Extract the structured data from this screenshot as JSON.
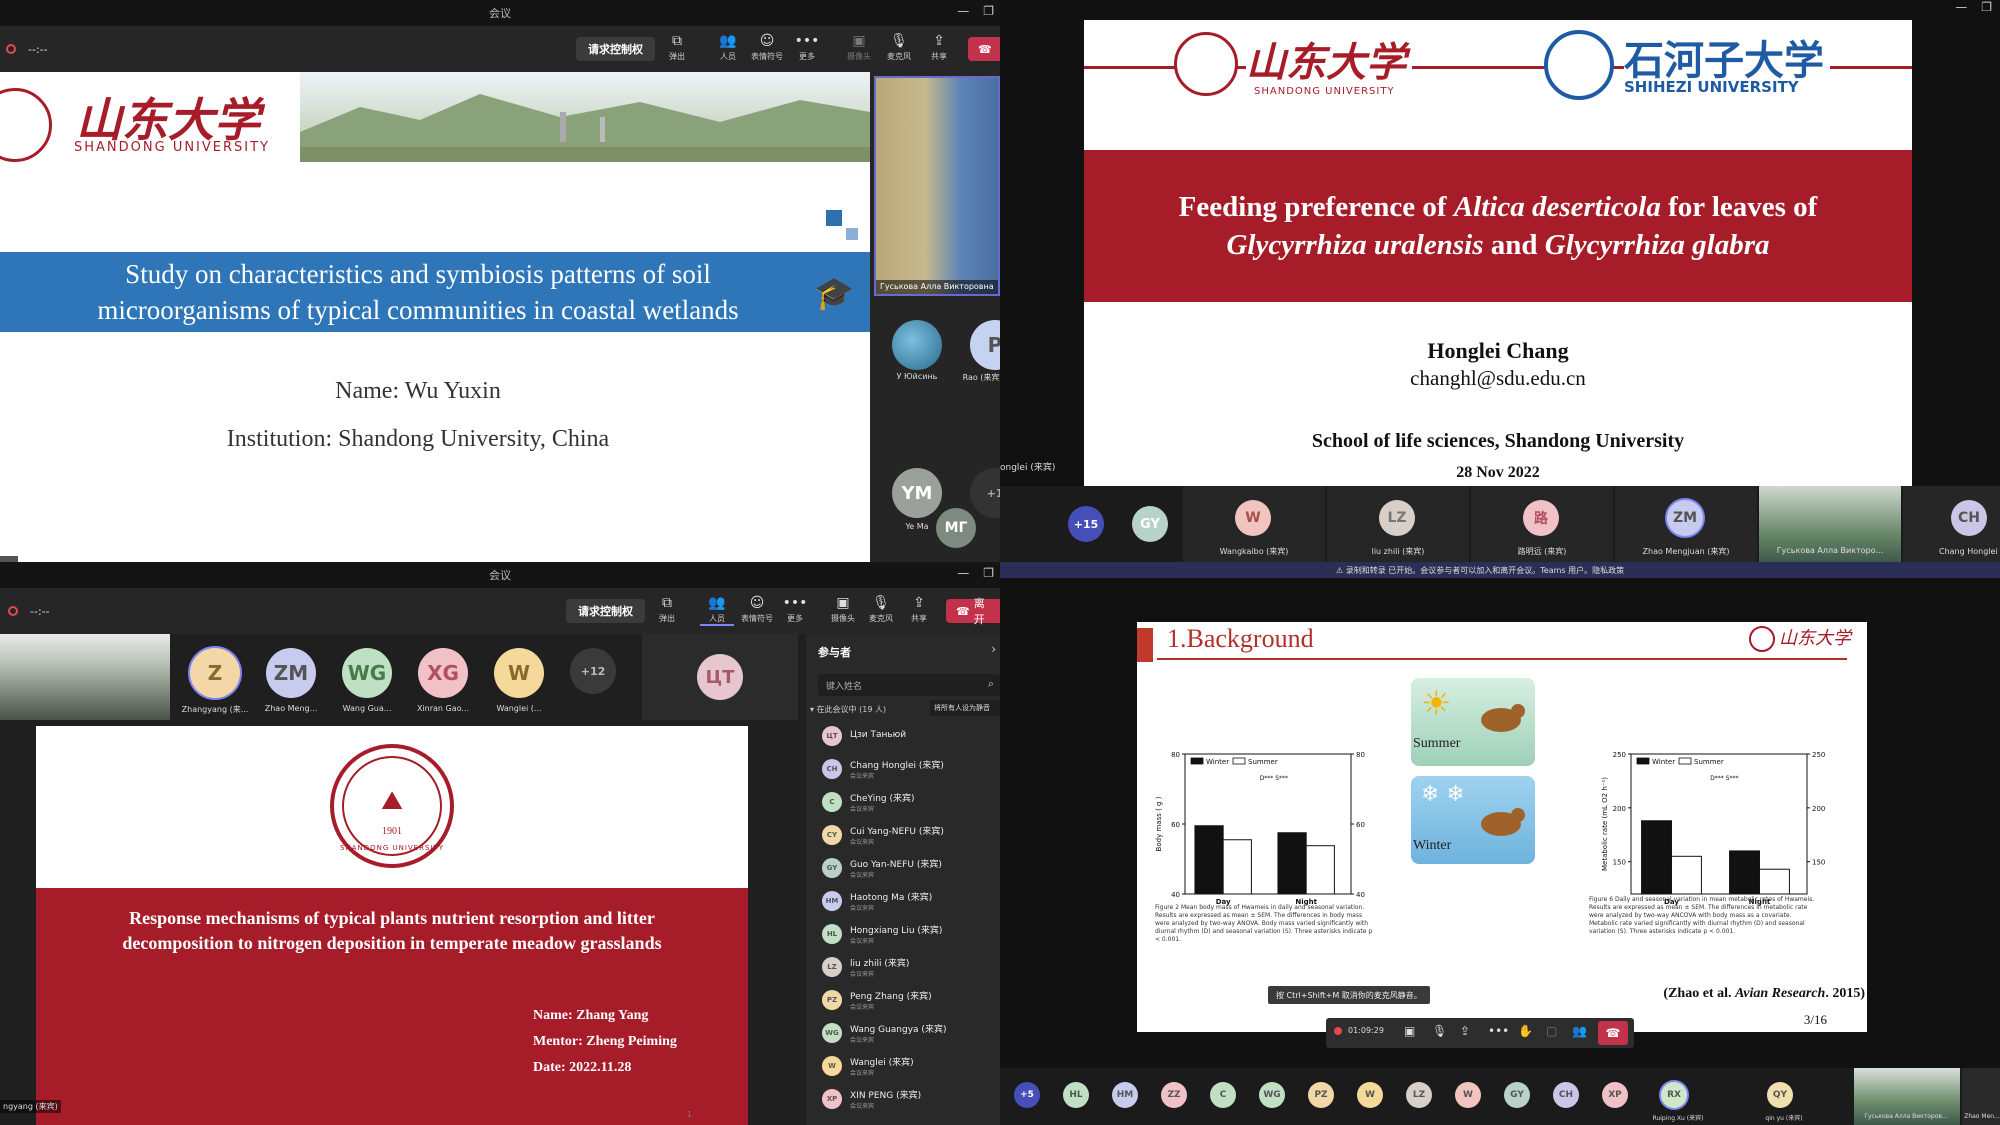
{
  "q1": {
    "window_title": "会议",
    "timer": "--:--",
    "request_control_label": "请求控制权",
    "toolbar": [
      {
        "icon": "pop-out-icon",
        "label": "弹出"
      },
      {
        "icon": "people-icon",
        "label": "人员"
      },
      {
        "icon": "reactions-icon",
        "label": "表情符号"
      },
      {
        "icon": "more-icon",
        "label": "更多"
      },
      {
        "icon": "camera-icon",
        "label": "摄像头"
      },
      {
        "icon": "mic-icon",
        "label": "麦克风"
      },
      {
        "icon": "share-icon",
        "label": "共享"
      }
    ],
    "slide": {
      "university_cn": "山东大学",
      "university_en": "SHANDONG UNIVERSITY",
      "title_line1": "Study on characteristics and symbiosis patterns of soil",
      "title_line2": "microorganisms of typical communities in coastal wetlands",
      "name": "Name: Wu Yuxin",
      "institution": "Institution: Shandong University, China"
    },
    "video_label": "Гуськова Алла Викторовна",
    "side_participants": [
      {
        "initials": "",
        "name": "У Юйсинь",
        "photo": true
      },
      {
        "initials": "P",
        "name": "Rao (来宾",
        "color": "#c6d3f0"
      },
      {
        "initials": "YM",
        "name": "Ye Ma",
        "color": "#9aa09a"
      },
      {
        "initials": "+1",
        "name": "",
        "color": "#333"
      },
      {
        "initials": "МГ",
        "name": "",
        "color": "#7d8a80"
      }
    ]
  },
  "q2": {
    "uni1_cn": "山东大学",
    "uni1_en": "SHANDONG UNIVERSITY",
    "uni2_cn": "石河子大学",
    "uni2_en": "SHIHEZI UNIVERSITY",
    "title_part1": "Feeding preference of ",
    "title_italic1": "Altica deserticola",
    "title_part2": " for leaves of",
    "title_italic2": "Glycyrrhiza uralensis",
    "title_part3": " and ",
    "title_italic3": "Glycyrrhiza glabra",
    "author": "Honglei Chang",
    "email": "changhl@sdu.edu.cn",
    "school": "School of life sciences, Shandong University",
    "date": "28 Nov 2022",
    "presenter_label": "onglei (来宾)",
    "strip": [
      {
        "initials": "+15",
        "name": "",
        "color": "#464eb8"
      },
      {
        "initials": "GY",
        "name": "",
        "color": "#b9d2c9"
      },
      {
        "initials": "W",
        "name": "Wangkaibo (来宾)",
        "color": "#f2c4c0"
      },
      {
        "initials": "LZ",
        "name": "liu zhili (来宾)",
        "color": "#d8cfc8"
      },
      {
        "initials": "路",
        "name": "路明远 (来宾)",
        "color": "#f0c2c8"
      },
      {
        "initials": "ZM",
        "name": "Zhao Mengjuan (来宾)",
        "color": "#c7cbee"
      },
      {
        "initials": "",
        "name": "Гуськова Алла Викторо...",
        "photo": true
      },
      {
        "initials": "CH",
        "name": "Chang Honglei (来宾)",
        "color": "#cbc6e8"
      }
    ],
    "notice": "录制和转录 已开始。会议参与者可以加入和离开会议。Teams 用户。隐私政策"
  },
  "q3": {
    "window_title": "会议",
    "timer": "--:--",
    "request_control_label": "请求控制权",
    "leave_label": "离开",
    "toolbar": [
      {
        "icon": "pop-out-icon",
        "label": "弹出"
      },
      {
        "icon": "people-icon",
        "label": "人员"
      },
      {
        "icon": "reactions-icon",
        "label": "表情符号"
      },
      {
        "icon": "more-icon",
        "label": "更多"
      },
      {
        "icon": "camera-icon",
        "label": "摄像头"
      },
      {
        "icon": "mic-icon",
        "label": "麦克风"
      },
      {
        "icon": "share-icon",
        "label": "共享"
      }
    ],
    "strip": [
      {
        "initials": "Z",
        "name": "Zhangyang (来...",
        "color": "#f3d7a6"
      },
      {
        "initials": "ZM",
        "name": "Zhao Meng...",
        "color": "#c7cbee"
      },
      {
        "initials": "WG",
        "name": "Wang Gua...",
        "color": "#bfe0c2"
      },
      {
        "initials": "XG",
        "name": "Xinran Gao...",
        "color": "#f0c2c8"
      },
      {
        "initials": "W",
        "name": "Wanglei (...",
        "color": "#f4d99a"
      },
      {
        "initials": "+12",
        "name": "",
        "color": "#3a3a3a"
      }
    ],
    "big_avatar": {
      "initials": "ЦТ",
      "color": "#e8c6d0"
    },
    "slide": {
      "year": "1901",
      "uni_en": "SHANDONG UNIVERSITY",
      "title_line1": "Response mechanisms of typical plants nutrient resorption and litter",
      "title_line2": "decomposition to nitrogen deposition in temperate meadow grasslands",
      "name": "Name:  Zhang Yang",
      "mentor": "Mentor:  Zheng Peiming",
      "date": "Date:  2022.11.28",
      "page": "1"
    },
    "presenter_label": "ngyang (来宾)",
    "panel": {
      "title": "参与者",
      "search_placeholder": "键入姓名",
      "mute_all_label": "将所有人设为静音",
      "group_label": "在此会议中 (19 人)",
      "participants": [
        {
          "initials": "ЦТ",
          "name": "Цзи Таньюй",
          "sub": "",
          "color": "#e8c6d0"
        },
        {
          "initials": "CH",
          "name": "Chang Honglei (来宾)",
          "sub": "会议来宾",
          "color": "#cbc6e8"
        },
        {
          "initials": "C",
          "name": "CheYing (来宾)",
          "sub": "会议来宾",
          "color": "#bfe0c2"
        },
        {
          "initials": "CY",
          "name": "Cui Yang-NEFU (来宾)",
          "sub": "会议来宾",
          "color": "#f3d7a6"
        },
        {
          "initials": "GY",
          "name": "Guo Yan-NEFU (来宾)",
          "sub": "会议来宾",
          "color": "#b9d2c9"
        },
        {
          "initials": "HM",
          "name": "Haotong Ma (来宾)",
          "sub": "会议来宾",
          "color": "#c7cbee"
        },
        {
          "initials": "HL",
          "name": "Hongxiang Liu (来宾)",
          "sub": "会议来宾",
          "color": "#bfe0c2"
        },
        {
          "initials": "LZ",
          "name": "liu zhili (来宾)",
          "sub": "会议来宾",
          "color": "#d8cfc8"
        },
        {
          "initials": "PZ",
          "name": "Peng Zhang (来宾)",
          "sub": "会议来宾",
          "color": "#f3d7a6"
        },
        {
          "initials": "WG",
          "name": "Wang Guangya (来宾)",
          "sub": "会议来宾",
          "color": "#bfe0c2"
        },
        {
          "initials": "W",
          "name": "Wanglei (来宾)",
          "sub": "会议来宾",
          "color": "#f4d99a"
        },
        {
          "initials": "XP",
          "name": "XIN PENG (来宾)",
          "sub": "会议来宾",
          "color": "#f0c2c8"
        }
      ]
    }
  },
  "q4": {
    "heading": "1.Background",
    "summer_label": "Summer",
    "winter_label": "Winter",
    "citation_prefix": "(Zhao et al. ",
    "citation_journal": "Avian Research",
    "citation_suffix": ". 2015)",
    "page": "3/16",
    "toast": "按 Ctrl+Shift+M 取消你的麦克风静音。",
    "call_timer": "01:09:29",
    "fig2_caption": "Figure 2 Mean body mass of Hwameis in daily and seasonal variation. Results are expressed as mean ± SEM. The differences in body mass were analyzed by two-way ANOVA. Body mass varied significantly with diurnal rhythm (D) and seasonal variation (S). Three asterisks indicate p < 0.001.",
    "fig6_caption": "Figure 6 Daily and seasonal variation in mean metabolic rates of Hwameis. Results are expressed as mean ± SEM. The differences in metabolic rate were analyzed by two-way ANCOVA with body mass as a covariate. Metabolic rate varied significantly with diurnal rhythm (D) and seasonal variation (S). Three asterisks indicate p < 0.001.",
    "strip": [
      {
        "initials": "+5",
        "color": "#464eb8"
      },
      {
        "initials": "HL",
        "color": "#bfe0c2"
      },
      {
        "initials": "HM",
        "color": "#c7cbee"
      },
      {
        "initials": "ZZ",
        "color": "#f0c2c8"
      },
      {
        "initials": "C",
        "color": "#bfe0c2"
      },
      {
        "initials": "WG",
        "color": "#bfe0c2"
      },
      {
        "initials": "PZ",
        "color": "#f3d7a6"
      },
      {
        "initials": "W",
        "color": "#f4d99a"
      },
      {
        "initials": "LZ",
        "color": "#d8cfc8"
      },
      {
        "initials": "W",
        "color": "#f2c4c0"
      },
      {
        "initials": "GY",
        "color": "#b9d2c9"
      },
      {
        "initials": "CH",
        "color": "#cbc6e8"
      },
      {
        "initials": "XP",
        "color": "#f0c2c8"
      },
      {
        "initials": "RX",
        "color": "#cfe8c8"
      },
      {
        "initials": "QY",
        "color": "#f0e0b0"
      }
    ],
    "strip_named": {
      "rx": "Ruiping Xu (来宾)",
      "qy": "qin yu (来宾)",
      "photo": "Гуськова Алла Викторов...",
      "last": "Zhao Men..."
    }
  },
  "chart_data": [
    {
      "type": "bar",
      "title": "",
      "xlabel": "",
      "ylabel": "Body mass ( g )",
      "categories": [
        "Day",
        "Night"
      ],
      "series": [
        {
          "name": "Winter",
          "values": [
            59.5,
            57.5
          ],
          "color": "#111111"
        },
        {
          "name": "Summer",
          "values": [
            55.5,
            53.8
          ],
          "color": "#ffffff"
        }
      ],
      "ylim": [
        40,
        80
      ],
      "yticks": [
        40,
        60,
        80
      ],
      "annotation": "D***  S***",
      "legend": "top-left"
    },
    {
      "type": "bar",
      "title": "",
      "xlabel": "",
      "ylabel": "Metabolic rate (mL O2 h⁻¹)",
      "categories": [
        "Day",
        "Night"
      ],
      "series": [
        {
          "name": "Winter",
          "values": [
            188,
            160
          ],
          "color": "#111111"
        },
        {
          "name": "Summer",
          "values": [
            155,
            143
          ],
          "color": "#ffffff"
        }
      ],
      "ylim": [
        120,
        250
      ],
      "yticks": [
        150,
        200,
        250
      ],
      "annotation": "D***  S***",
      "legend": "top-left"
    }
  ]
}
